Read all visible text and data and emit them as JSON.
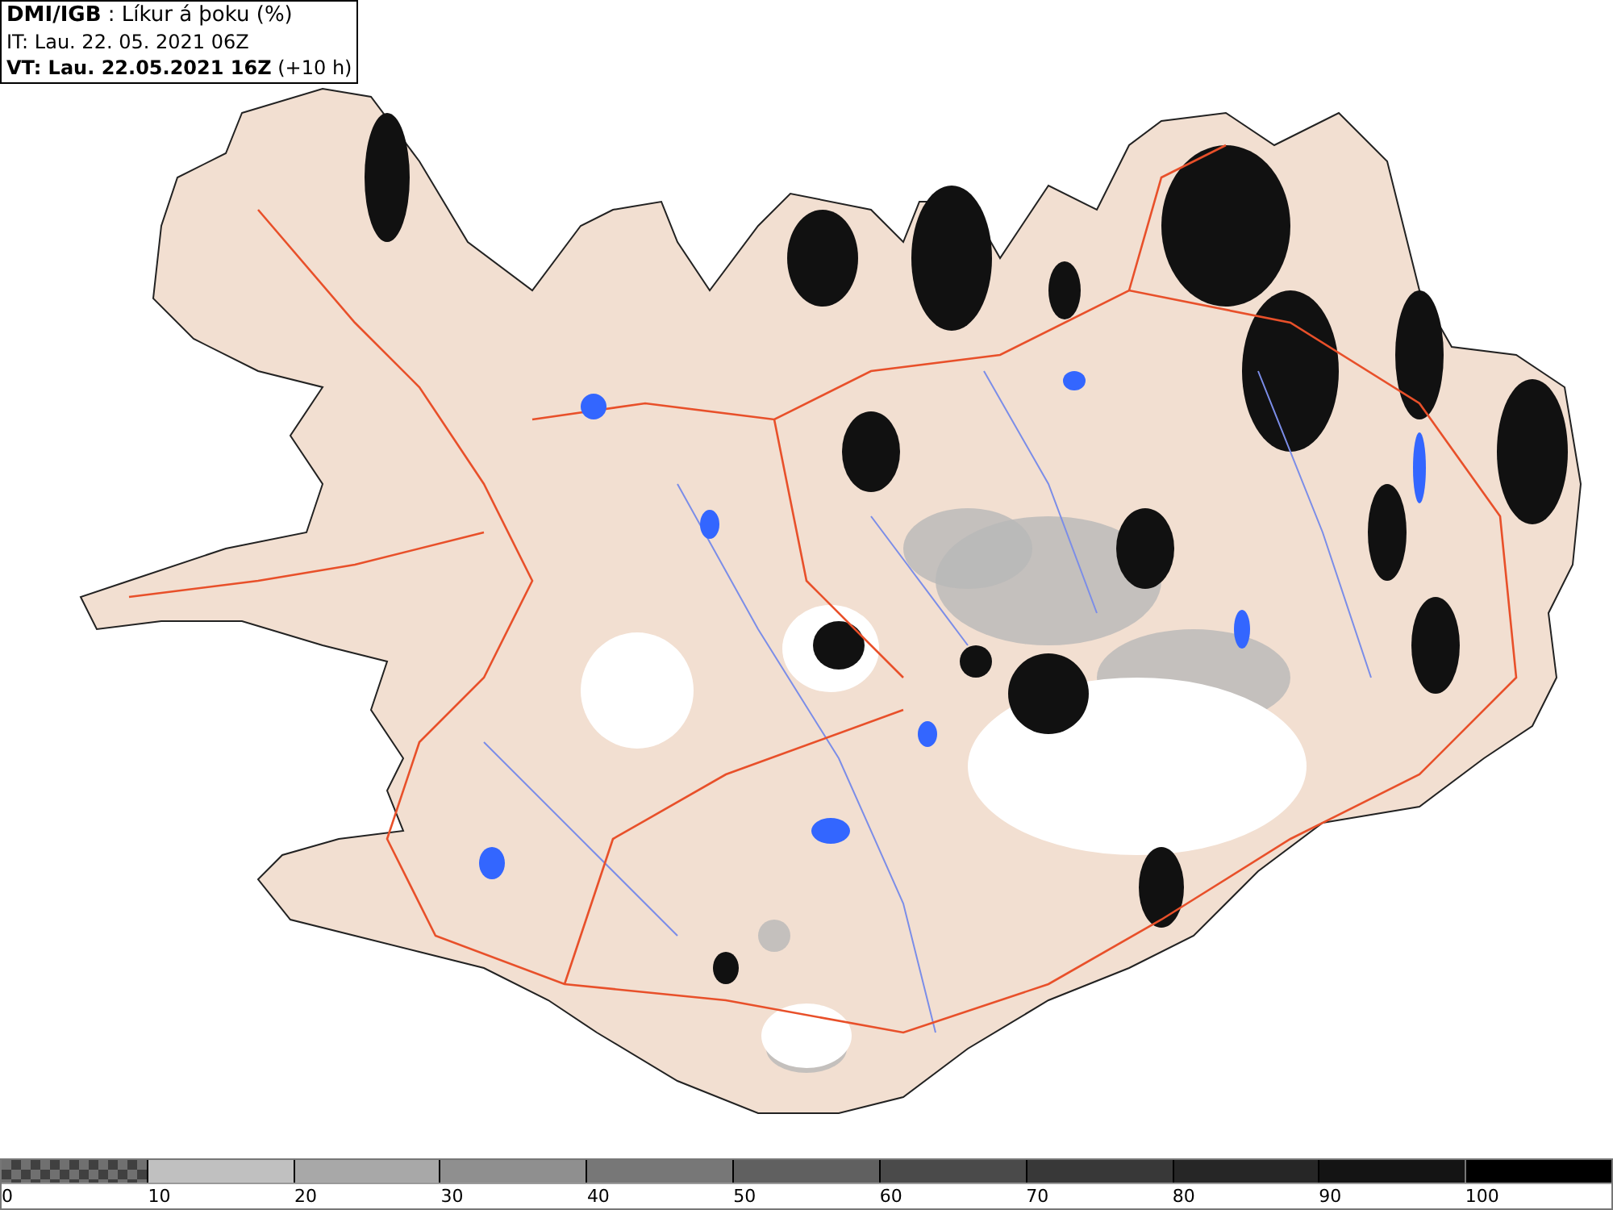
{
  "header": {
    "lines": [
      "**DMI/IGB** : Líkur á þoku (%)",
      "IT: Lau. 22. 05. 2021 06Z",
      "**VT: Lau. 22.05.2021 16Z** (+10 h)"
    ]
  },
  "legend": [
    {
      "label": "0",
      "kind": "checker",
      "color": "#707070"
    },
    {
      "label": "10",
      "kind": "solid",
      "color": "#c0c0c0"
    },
    {
      "label": "20",
      "kind": "solid",
      "color": "#a8a8a8"
    },
    {
      "label": "30",
      "kind": "solid",
      "color": "#8f8f8f"
    },
    {
      "label": "40",
      "kind": "solid",
      "color": "#777777"
    },
    {
      "label": "50",
      "kind": "solid",
      "color": "#606060"
    },
    {
      "label": "60",
      "kind": "solid",
      "color": "#4a4a4a"
    },
    {
      "label": "70",
      "kind": "solid",
      "color": "#383838"
    },
    {
      "label": "80",
      "kind": "solid",
      "color": "#262626"
    },
    {
      "label": "90",
      "kind": "solid",
      "color": "#141414"
    },
    {
      "label": "100",
      "kind": "solid",
      "color": "#000000"
    }
  ]
}
